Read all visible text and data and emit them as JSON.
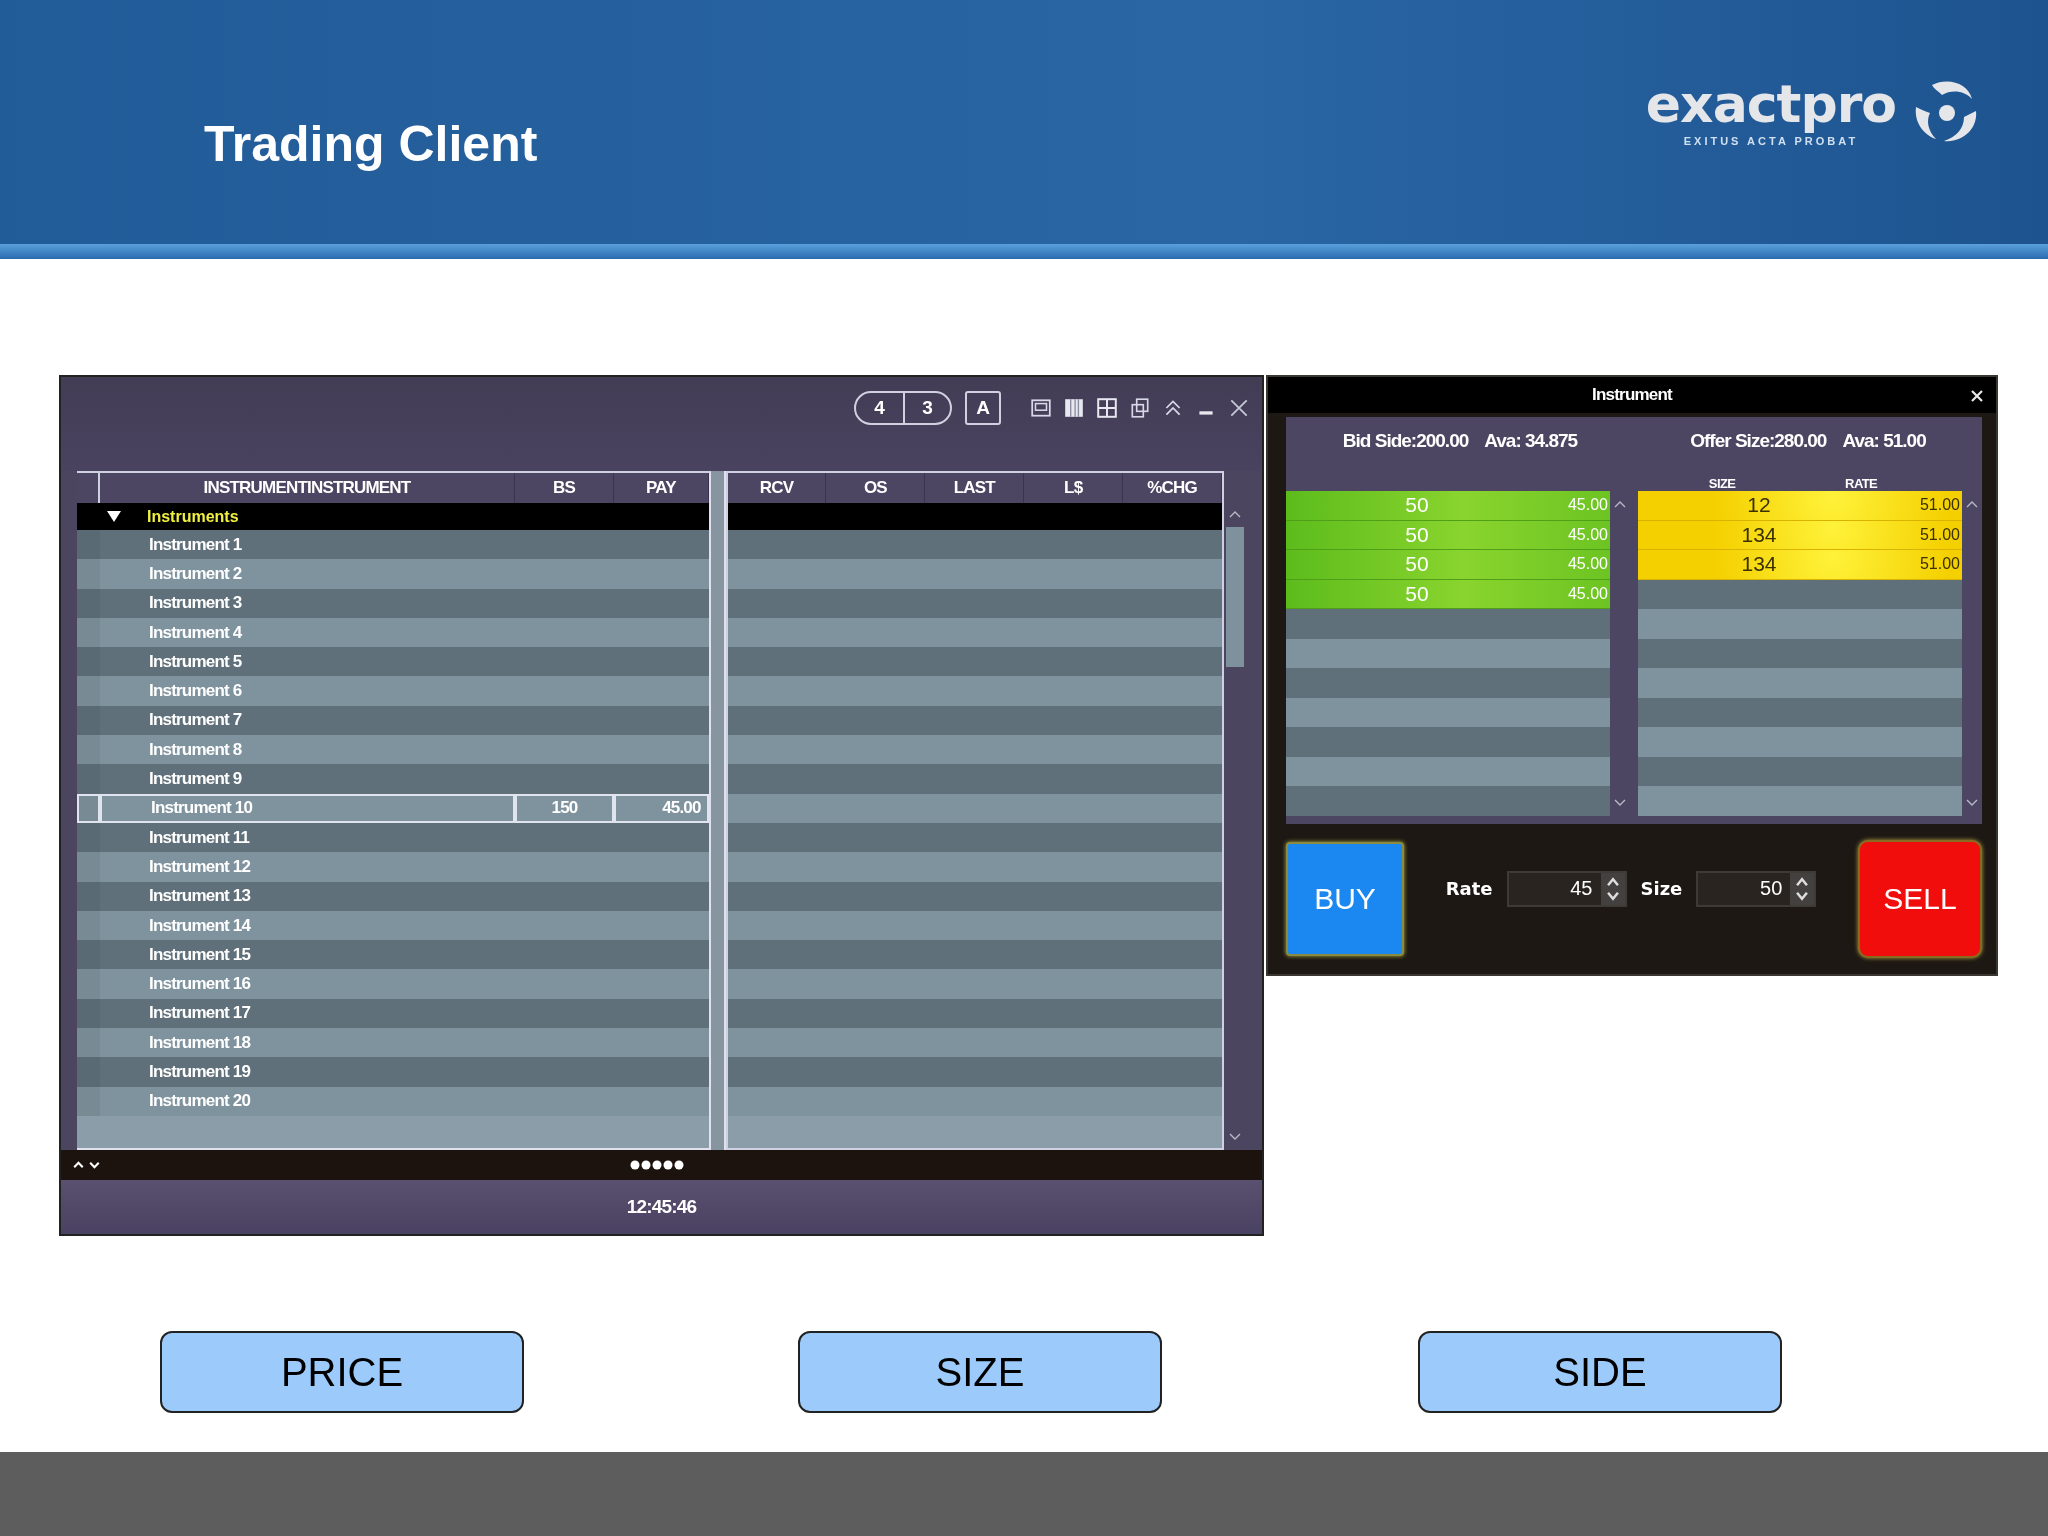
{
  "slide": {
    "title": "Trading Client",
    "logo": {
      "name": "exactpro",
      "tagline": "EXITUS ACTA PROBAT"
    }
  },
  "instrument_grid": {
    "toolbar": {
      "layout_buttons": [
        "4",
        "3"
      ],
      "auto_button": "A"
    },
    "left_columns": [
      "INSTRUMENTINSTRUMENT",
      "BS",
      "PAY"
    ],
    "right_columns": [
      "RCV",
      "OS",
      "LAST",
      "L$",
      "%CHG"
    ],
    "group": {
      "label": "Instruments",
      "expanded": true
    },
    "rows": [
      {
        "instrument": "Instrument 1",
        "selected": false
      },
      {
        "instrument": "Instrument 2",
        "selected": false
      },
      {
        "instrument": "Instrument 3",
        "selected": false
      },
      {
        "instrument": "Instrument 4",
        "selected": false
      },
      {
        "instrument": "Instrument 5",
        "selected": false
      },
      {
        "instrument": "Instrument 6",
        "selected": false
      },
      {
        "instrument": "Instrument 7",
        "selected": false
      },
      {
        "instrument": "Instrument 8",
        "selected": false
      },
      {
        "instrument": "Instrument 9",
        "selected": false
      },
      {
        "instrument": "Instrument 10",
        "bs": "150",
        "pay": "45.00",
        "selected": true
      },
      {
        "instrument": "Instrument 11",
        "selected": false
      },
      {
        "instrument": "Instrument 12",
        "selected": false
      },
      {
        "instrument": "Instrument 13",
        "selected": false
      },
      {
        "instrument": "Instrument 14",
        "selected": false
      },
      {
        "instrument": "Instrument 15",
        "selected": false
      },
      {
        "instrument": "Instrument 16",
        "selected": false
      },
      {
        "instrument": "Instrument 17",
        "selected": false
      },
      {
        "instrument": "Instrument 18",
        "selected": false
      },
      {
        "instrument": "Instrument 19",
        "selected": false
      },
      {
        "instrument": "Instrument 20",
        "selected": false
      }
    ],
    "status_bar": {
      "time": "12:45:46"
    }
  },
  "order_ticket": {
    "title": "Instrument",
    "bid_summary": {
      "side": "Bid Side:200.00",
      "average": "Ava: 34.875"
    },
    "offer_summary": {
      "size": "Offer Size:280.00",
      "average": "Ava: 51.00"
    },
    "offer_columns": [
      "SIZE",
      "RATE"
    ],
    "bids": [
      {
        "size": "50",
        "rate": "45.00"
      },
      {
        "size": "50",
        "rate": "45.00"
      },
      {
        "size": "50",
        "rate": "45.00"
      },
      {
        "size": "50",
        "rate": "45.00"
      }
    ],
    "offers": [
      {
        "size": "12",
        "rate": "51.00"
      },
      {
        "size": "134",
        "rate": "51.00"
      },
      {
        "size": "134",
        "rate": "51.00"
      }
    ],
    "rate_field": {
      "label": "Rate",
      "value": "45"
    },
    "size_field": {
      "label": "Size",
      "value": "50"
    },
    "buy_button": "BUY",
    "sell_button": "SELL"
  },
  "actions": [
    "PRICE",
    "SIZE",
    "SIDE"
  ]
}
